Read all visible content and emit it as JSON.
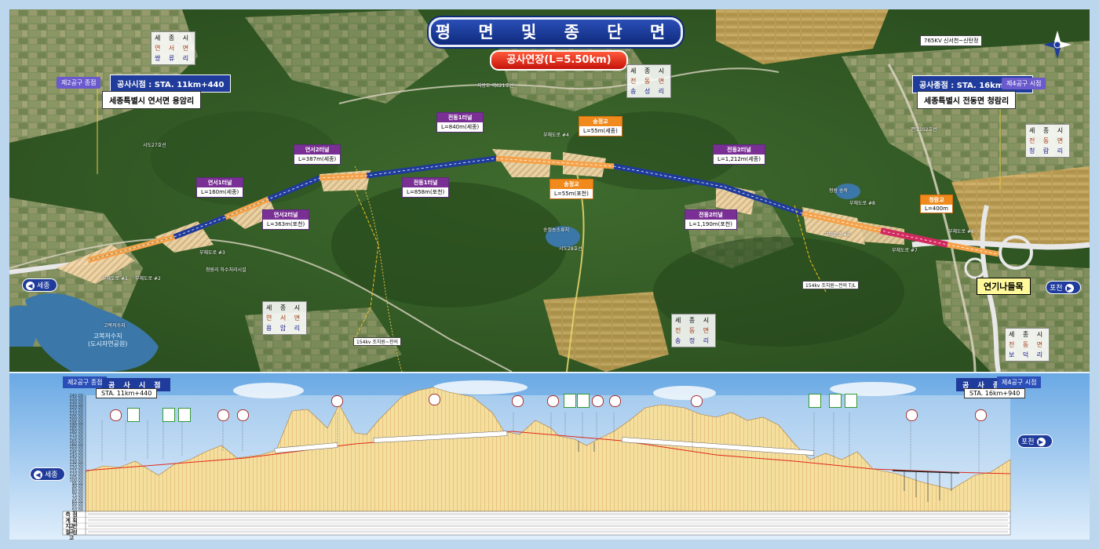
{
  "title": "평 면 및 종 단 면 도",
  "length_label": "공사연장(L=5.50km)",
  "start": {
    "zone_tag": "제2공구 종점",
    "sta": "공사시점 : STA. 11km+440",
    "address": "세종특별시 연서면 용암리"
  },
  "end": {
    "zone_tag": "제4공구 시점",
    "sta": "공사종점 : STA. 16km+940",
    "address": "세종특별시 전동면 청람리"
  },
  "power_line_top": "765KV 신서천~신탄정",
  "villages": [
    {
      "city": "세 종 시",
      "myeon": "연 서 면",
      "ri": "쌍 류 리"
    },
    {
      "city": "세 종 시",
      "myeon": "전 동 면",
      "ri": "송 성 리"
    },
    {
      "city": "세 종 시",
      "myeon": "전 동 면",
      "ri": "청 람 리"
    },
    {
      "city": "세 종 시",
      "myeon": "연 서 면",
      "ri": "용 암 리"
    },
    {
      "city": "세 종 시",
      "myeon": "전 동 면",
      "ri": "송 정 리"
    },
    {
      "city": "세 종 시",
      "myeon": "전 동 면",
      "ri": "보 덕 리"
    }
  ],
  "tunnels": [
    {
      "name": "연서1터널",
      "length": "L=160m(세종)"
    },
    {
      "name": "연서2터널",
      "length": "L=363m(포천)"
    },
    {
      "name": "연서2터널",
      "length": "L=387m(세종)"
    },
    {
      "name": "전동1터널",
      "length": "L=858m(포천)"
    },
    {
      "name": "전동1터널",
      "length": "L=840m(세종)"
    },
    {
      "name": "전동2터널",
      "length": "L=1,212m(세종)"
    },
    {
      "name": "전동2터널",
      "length": "L=1,190m(포천)"
    }
  ],
  "bridges": [
    {
      "name": "송정교",
      "length": "L=55m(세종)"
    },
    {
      "name": "송정교",
      "length": "L=55m(포천)"
    },
    {
      "name": "청람교",
      "length": "L=400m"
    }
  ],
  "junction": "연기나들목",
  "dir_left": "세종",
  "dir_right": "포천",
  "lake_name": "고복저수지",
  "lake_sub": "(도시자연공원)",
  "power_line_1": "154kv 조치원~천의",
  "power_line_2": "154kv 조치원~전의 T/L",
  "road_labels": [
    "시도27호선",
    "지방도 제621호선",
    "부체도로 #1",
    "부체도로 #2",
    "부체도로 #3",
    "부체도로 #4",
    "부체도로 #5",
    "부체도로 #6",
    "부체도로 #7",
    "부체도로 #8",
    "면도102호선",
    "시도28호선",
    "고복저수지",
    "송정농소류지",
    "청람 송학",
    "청람리 하수처리시설"
  ],
  "profile": {
    "start_tag": "제2공구 종점",
    "start_head": "공 사 시 점",
    "start_sta": "STA. 11km+440",
    "end_tag": "제4공구 시점",
    "end_head": "공 사 종 점",
    "end_sta": "STA. 16km+940",
    "y_ticks": [
      "240.00",
      "235.00",
      "230.00",
      "225.00",
      "220.00",
      "215.00",
      "210.00",
      "205.00",
      "200.00",
      "195.00",
      "190.00",
      "185.00",
      "180.00",
      "175.00",
      "170.00",
      "165.00",
      "160.00",
      "155.00",
      "150.00",
      "145.00",
      "140.00",
      "135.00",
      "130.00",
      "125.00",
      "120.00",
      "115.00",
      "110.00",
      "105.00",
      "100.00",
      "95.00",
      "90.00",
      "85.00",
      "80.00",
      "75.00",
      "70.00",
      "65.00",
      "60.00",
      "55.00",
      "50.00"
    ],
    "rows": [
      "측 점",
      "계 획 고",
      "지 반 고",
      "절 성 고"
    ],
    "dir_left": "세종",
    "dir_right": "포천"
  },
  "colors": {
    "frame": "#bcd6ee",
    "title_bg": "#1f3b9b",
    "length_bg": "#e0281a",
    "tunnel": "#7a2f94",
    "bridge": "#f08a1c",
    "road_earthwork": "#f5c36a",
    "tunnel_line": "#1f3b9b",
    "ground_fill": "#f4df9e"
  }
}
